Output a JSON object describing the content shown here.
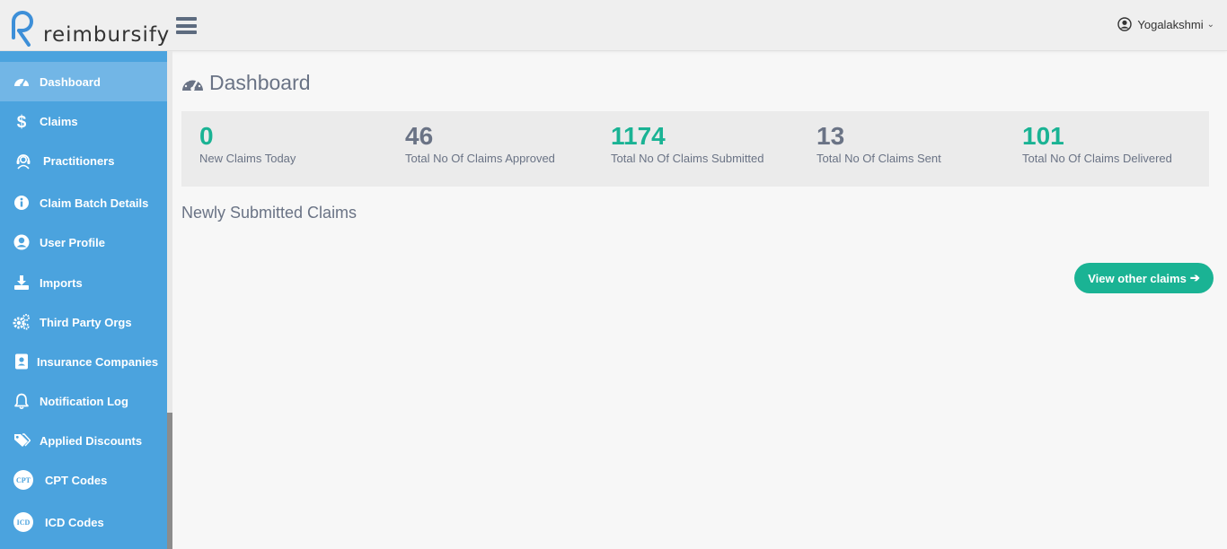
{
  "app": {
    "logo_text": "reimbursify"
  },
  "header": {
    "user_name": "Yogalakshmi",
    "user_caret": "⌄"
  },
  "sidebar": {
    "items": [
      {
        "label": "Dashboard",
        "icon": "dashboard-icon"
      },
      {
        "label": "Claims",
        "icon": "dollar-icon"
      },
      {
        "label": "Practitioners",
        "icon": "headset-icon"
      },
      {
        "label": "Claim Batch Details",
        "icon": "info-icon"
      },
      {
        "label": "User Profile",
        "icon": "user-circle-icon"
      },
      {
        "label": "Imports",
        "icon": "download-icon"
      },
      {
        "label": "Third Party Orgs",
        "icon": "gears-icon"
      },
      {
        "label": "Insurance Companies",
        "icon": "address-book-icon"
      },
      {
        "label": "Notification Log",
        "icon": "bell-icon"
      },
      {
        "label": "Applied Discounts",
        "icon": "tags-icon"
      },
      {
        "label": "CPT Codes",
        "icon": "cpt-badge-icon",
        "badge": "CPT"
      },
      {
        "label": "ICD Codes",
        "icon": "icd-badge-icon",
        "badge": "ICD"
      }
    ]
  },
  "main": {
    "title": "Dashboard",
    "stats": [
      {
        "value": "0",
        "label": "New Claims Today",
        "color": "#1ab394"
      },
      {
        "value": "46",
        "label": "Total No Of Claims Approved",
        "color": "#6a7385"
      },
      {
        "value": "1174",
        "label": "Total No Of Claims Submitted",
        "color": "#1ab394"
      },
      {
        "value": "13",
        "label": "Total No Of Claims Sent",
        "color": "#6a7385"
      },
      {
        "value": "101",
        "label": "Total No Of Claims Delivered",
        "color": "#1ab394"
      }
    ],
    "section_title": "Newly Submitted Claims",
    "view_button": "View other claims",
    "view_button_arrow": "➔"
  },
  "colors": {
    "sidebar": "#4ba3de",
    "sidebar_active": "#72b6e6",
    "accent_green": "#1ab394",
    "text_gray": "#6a7385"
  }
}
